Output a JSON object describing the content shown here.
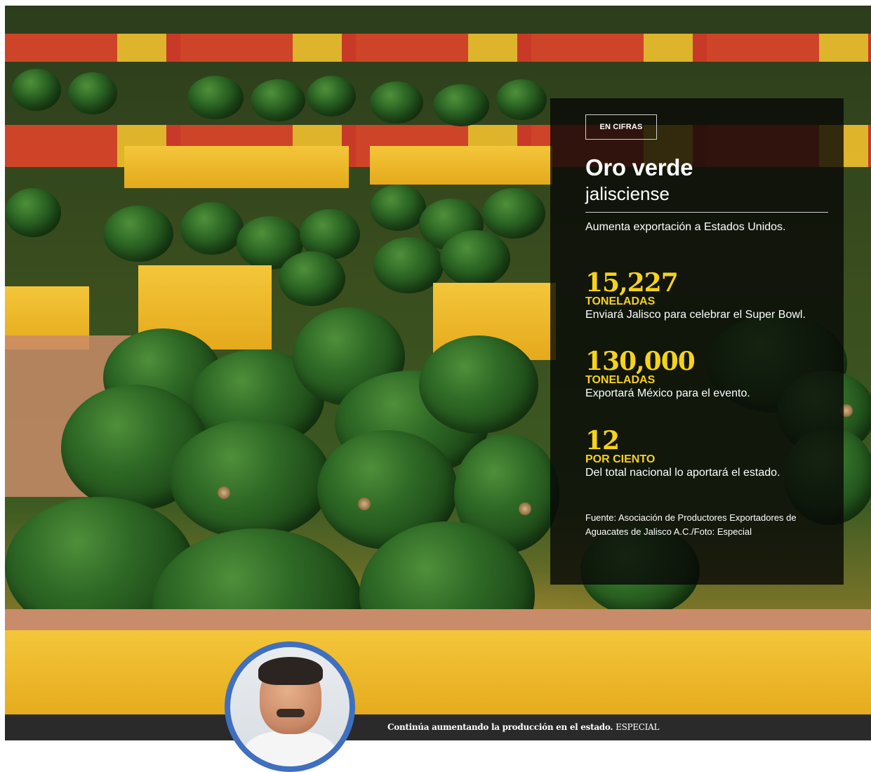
{
  "panel": {
    "tag": "EN CIFRAS",
    "title": "Oro verde",
    "subtitle": "jalisciense",
    "lead": "Aumenta exportación a Estados Unidos.",
    "stats": [
      {
        "number": "15,227",
        "unit": "TONELADAS",
        "desc": "Enviará Jalisco para celebrar el Super Bowl."
      },
      {
        "number": "130,000",
        "unit": "TONELADAS",
        "desc": "Exportará México para el evento."
      },
      {
        "number": "12",
        "unit": "POR CIENTO",
        "desc": "Del total nacional lo aportará el estado."
      }
    ],
    "source_line1": "Fuente: Asociación de Productores Exportadores de",
    "source_line2": "Aguacates de Jalisco A.C./Foto: Especial"
  },
  "caption": {
    "text": "Continúa aumentando la producción en el estado.",
    "credit": "ESPECIAL"
  },
  "colors": {
    "accent_yellow": "#f7d21a",
    "panel_bg": "#080806",
    "caption_bar": "#2a2a2a",
    "avatar_ring": "#3f6fbf"
  }
}
